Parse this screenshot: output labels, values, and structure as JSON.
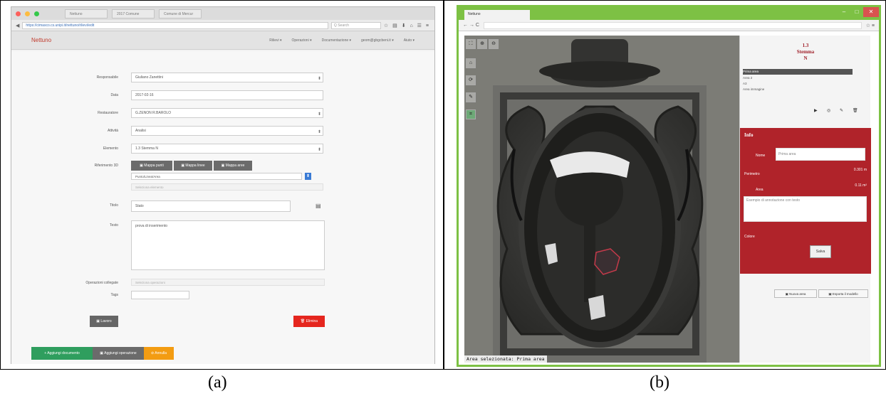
{
  "captions": {
    "a": "(a)",
    "b": "(b)"
  },
  "panel_a": {
    "browser": {
      "tabs": [
        "Nettuno",
        "2017 Comune",
        "Comune di Mercur"
      ],
      "url": "https://cimasco.cs.unipi.it/nettuno/rilievi/edit",
      "search_placeholder": "Q Search",
      "tools": "☆ ▤ ⬇ ⌂ ☰ ≡"
    },
    "app": {
      "brand": "Nettuno",
      "nav": [
        "Rilievi ▾",
        "Operazioni ▾",
        "Documentazione ▾",
        "geom@gbgcbeni.it ▾",
        "Aiuto ▾"
      ]
    },
    "form": {
      "fields": [
        {
          "label": "Responsabile",
          "value": "Giuliano Zanettini",
          "type": "select"
        },
        {
          "label": "Data",
          "value": "2017-02-16",
          "type": "input"
        },
        {
          "label": "Restauratore",
          "value": "G.ZENON R.BAROLO",
          "type": "select"
        },
        {
          "label": "Attività",
          "value": "Analisi",
          "type": "select"
        },
        {
          "label": "Elemento",
          "value": "1.3 Stemma N",
          "type": "select"
        }
      ],
      "riferimento_label": "Riferimento 3D",
      "btn_punti": "▣ Mappa punti",
      "btn_linee": "▣ Mappa linee",
      "btn_aree": "▣ Mappa aree",
      "riferimento_select": "Punto/Linea/Area",
      "riferimento_placeholder": "Seleziona elemento",
      "titolo_label": "Titolo",
      "titolo_value": "Stato",
      "testo_label": "Testo",
      "testo_value": "prova di inserimento",
      "operazioni_label": "Operazioni collegate",
      "operazioni_placeholder": "Seleziona operazioni",
      "tags_label": "Tags",
      "btn_lavoro": "▣ Lavoro",
      "btn_elimina": "🗑 Elimina",
      "btn_aggiungi": "+ Aggiungi documento",
      "btn_aggiungi_operazione": "▣ Aggiungi operazione",
      "btn_annulla": "⊘ Annulla"
    }
  },
  "panel_b": {
    "browser": {
      "tab": "Nettuno",
      "nav": "← → C",
      "star": "☆ ≡"
    },
    "viewer": {
      "selection_text": "Area selezionata: Prima area"
    },
    "side": {
      "title_line1": "1.3",
      "title_line2": "Stemma",
      "title_line3": "N",
      "list": [
        "Prima area",
        "Area 2",
        "A3",
        "Area immagine"
      ],
      "icons": [
        "▶",
        "◎",
        "✎",
        "🗑"
      ],
      "card_title": "Info",
      "nome_label": "Nome",
      "nome_value": "Prima area",
      "perimetro_label": "Perimetro",
      "perimetro_value": "0.301 m",
      "area_label": "Area",
      "area_value": "0.11 m²",
      "note_placeholder": "Esempio di annotazione con testo",
      "colore_label": "Colore",
      "salva": "Salva",
      "btn_nuova": "▣ Nuova area",
      "btn_esporta": "▣ Esporta il modello"
    }
  }
}
